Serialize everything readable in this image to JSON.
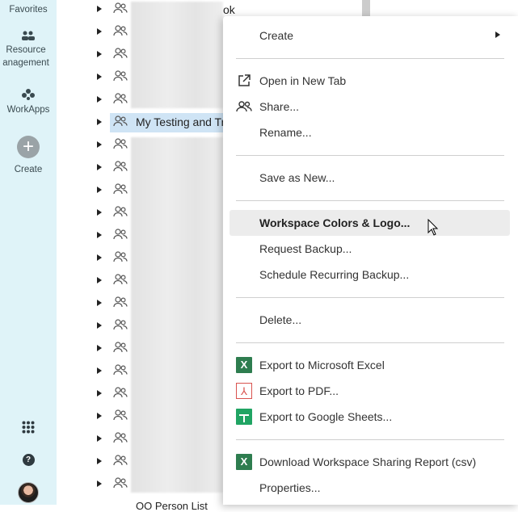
{
  "rail": {
    "favorites": "Favorites",
    "resource_management": "Resource\nanagement",
    "workapps": "WorkApps",
    "create": "Create"
  },
  "tree": {
    "selected_label": "My Testing and Tr",
    "peek_top": "ok",
    "peek_bottom": "OO Person List"
  },
  "menu": {
    "create": "Create",
    "open_new_tab": "Open in New Tab",
    "share": "Share...",
    "rename": "Rename...",
    "save_as_new": "Save as New...",
    "workspace_colors": "Workspace Colors & Logo...",
    "request_backup": "Request Backup...",
    "schedule_backup": "Schedule Recurring Backup...",
    "delete": "Delete...",
    "export_excel": "Export to Microsoft Excel",
    "export_pdf": "Export to PDF...",
    "export_sheets": "Export to Google Sheets...",
    "download_report": "Download Workspace Sharing Report (csv)",
    "properties": "Properties..."
  },
  "icons": {
    "excel_glyph": "X"
  }
}
